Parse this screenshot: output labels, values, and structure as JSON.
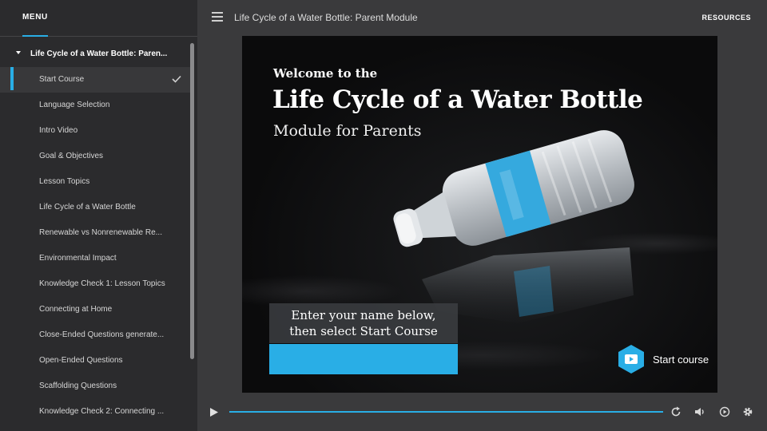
{
  "sidebar": {
    "menu_title": "MENU",
    "module_title": "Life Cycle of a Water Bottle: Paren...",
    "lessons": [
      {
        "label": "Start Course",
        "active": true,
        "completed": true
      },
      {
        "label": "Language Selection"
      },
      {
        "label": "Intro Video"
      },
      {
        "label": "Goal & Objectives"
      },
      {
        "label": "Lesson Topics"
      },
      {
        "label": "Life Cycle of a Water Bottle"
      },
      {
        "label": "Renewable vs Nonrenewable Re..."
      },
      {
        "label": "Environmental Impact"
      },
      {
        "label": "Knowledge Check 1: Lesson Topics"
      },
      {
        "label": "Connecting at Home"
      },
      {
        "label": "Close-Ended Questions generate..."
      },
      {
        "label": "Open-Ended Questions"
      },
      {
        "label": "Scaffolding Questions"
      },
      {
        "label": "Knowledge Check 2: Connecting ..."
      }
    ]
  },
  "topbar": {
    "course_title": "Life Cycle of a Water Bottle: Parent Module",
    "resources_label": "RESOURCES",
    "menu_icon": "hamburger-menu-icon"
  },
  "slide": {
    "welcome": "Welcome to the",
    "title": "Life Cycle of a Water Bottle",
    "subtitle": "Module for Parents",
    "prompt_line1": "Enter your name below,",
    "prompt_line2": "then select Start Course",
    "name_value": "",
    "start_label": "Start course",
    "start_icon": "play-video-hex-icon"
  },
  "player": {
    "progress": 1.0,
    "icons": [
      "play-icon",
      "replay-icon",
      "volume-icon",
      "captions-icon",
      "settings-gear-icon"
    ]
  },
  "colors": {
    "accent": "#29aee6",
    "sidebar_bg": "#2b2b2d",
    "app_bg": "#3a3a3c"
  }
}
